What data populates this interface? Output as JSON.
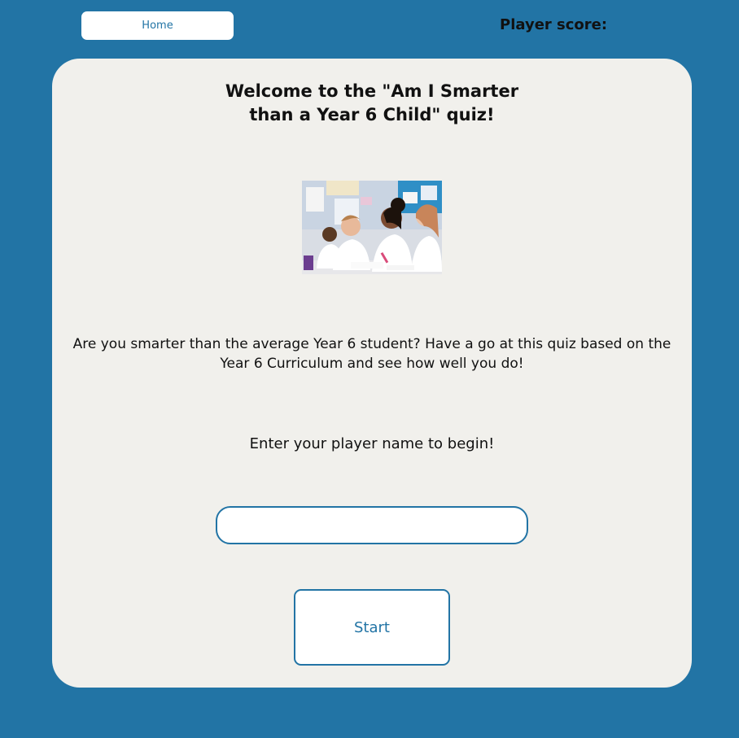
{
  "nav": {
    "home_label": "Home"
  },
  "header": {
    "score_label": "Player score:"
  },
  "main": {
    "title_line1": "Welcome to the \"Am I Smarter",
    "title_line2": "than a Year 6 Child\" quiz!",
    "intro": "Are you smarter than the average Year 6 student? Have a go at this quiz based on the Year 6 Curriculum and see how well you do!",
    "prompt": "Enter your player name to begin!",
    "name_input": {
      "value": "",
      "placeholder": ""
    },
    "start_label": "Start"
  },
  "colors": {
    "background": "#2274a5",
    "card": "#f1f0ec",
    "accent": "#2274a5",
    "button_bg": "#ffffff",
    "text": "#111111"
  }
}
